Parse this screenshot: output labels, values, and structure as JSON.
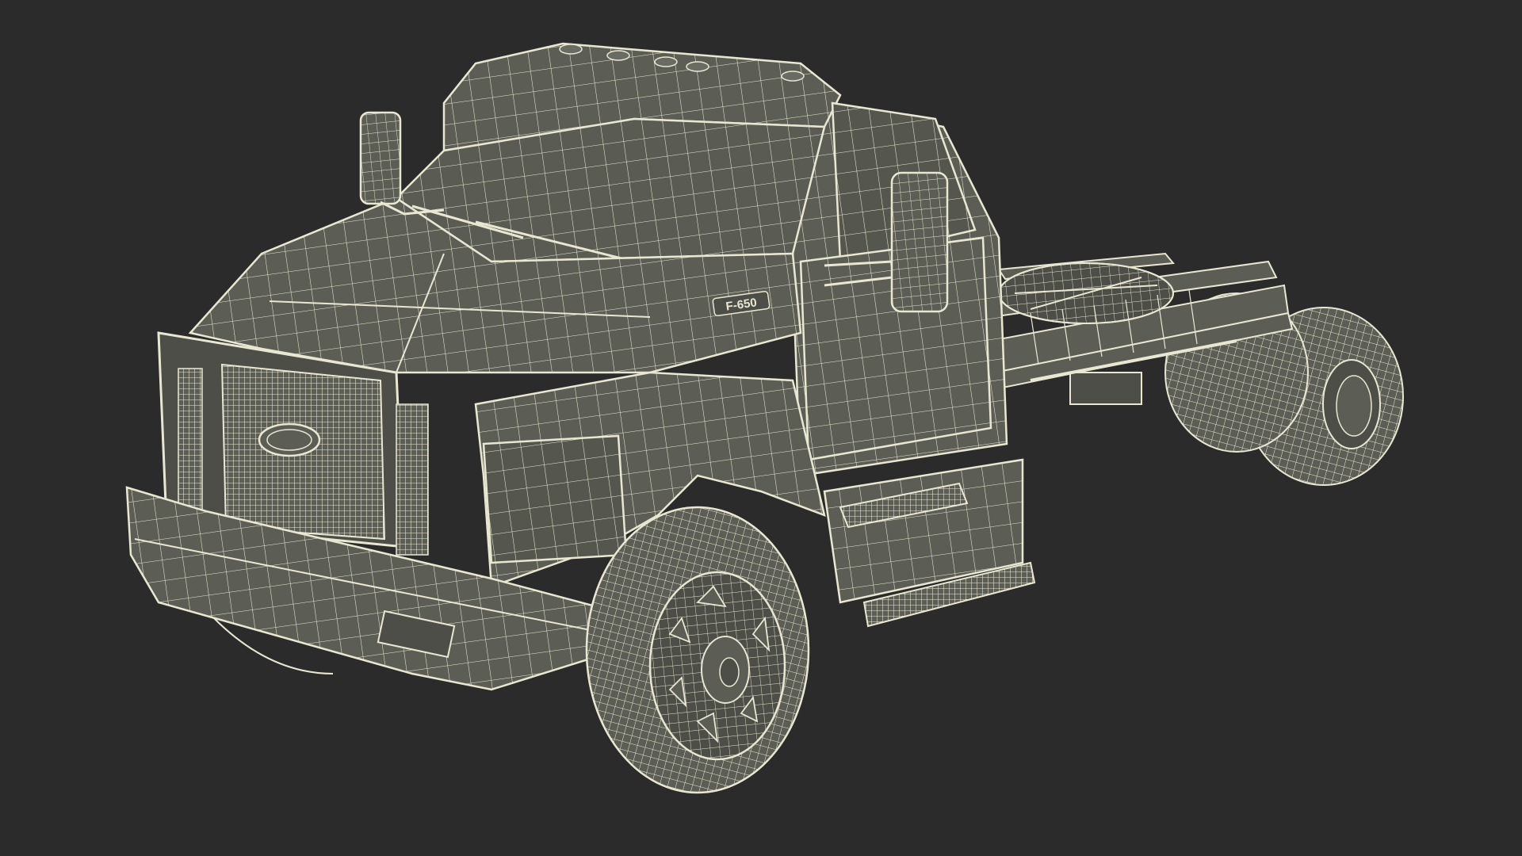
{
  "scene": {
    "background": "#2b2b2b",
    "fill": "#5c5e56",
    "fill_dark": "#4c4e47",
    "fill_light": "#6a6c63",
    "wire": "#e8e8d2",
    "wire_soft": "#cfcfb8",
    "grille_text": "",
    "badge_text": "F-650"
  }
}
